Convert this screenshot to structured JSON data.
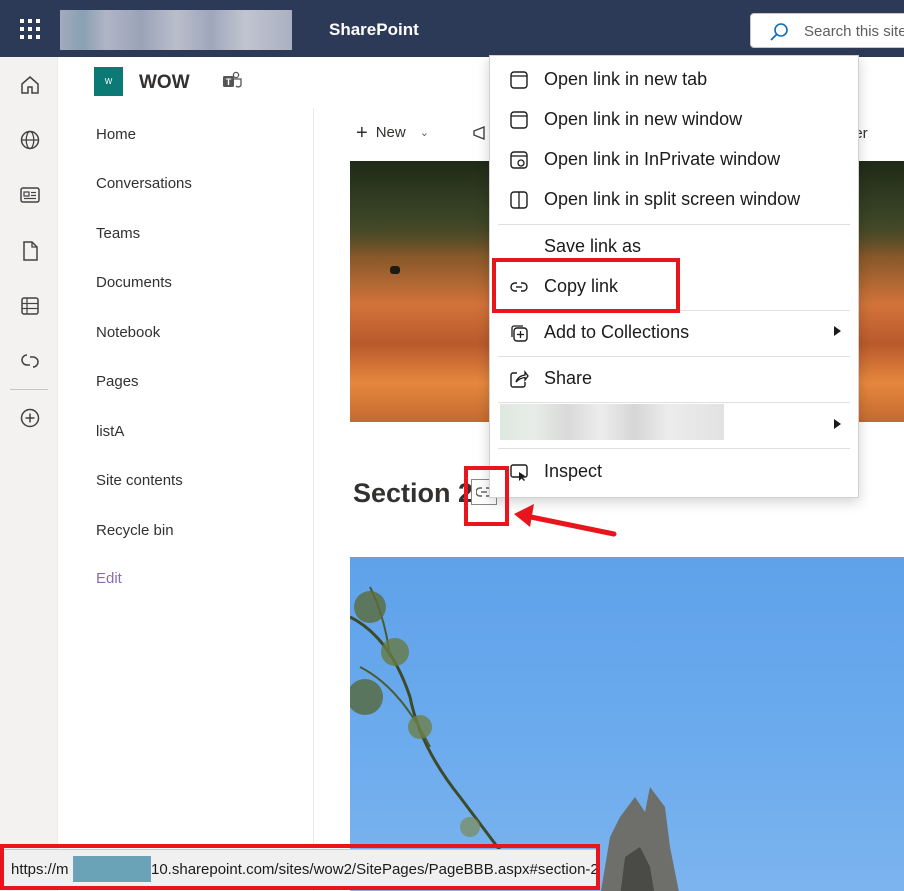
{
  "suite_bar": {
    "app_name": "SharePoint",
    "search_placeholder": "Search this site"
  },
  "app_bar": {
    "icons": [
      "home-icon",
      "globe-icon",
      "news-icon",
      "file-icon",
      "list-icon",
      "loop-icon",
      "add-icon"
    ]
  },
  "site": {
    "logo_text": "W",
    "name": "WOW"
  },
  "left_nav": {
    "items": [
      {
        "label": "Home"
      },
      {
        "label": "Conversations"
      },
      {
        "label": "Teams"
      },
      {
        "label": "Documents"
      },
      {
        "label": "Notebook"
      },
      {
        "label": "Pages"
      },
      {
        "label": "listA"
      },
      {
        "label": "Site contents"
      },
      {
        "label": "Recycle bin"
      }
    ],
    "edit_label": "Edit"
  },
  "command_bar": {
    "new_label": "New",
    "right_partial": "der"
  },
  "page": {
    "section_title": "Section 2"
  },
  "context_menu": {
    "items": [
      {
        "label": "Open link in new tab",
        "icon": "new-tab-icon"
      },
      {
        "label": "Open link in new window",
        "icon": "new-window-icon"
      },
      {
        "label": "Open link in InPrivate window",
        "icon": "inprivate-icon"
      },
      {
        "label": "Open link in split screen window",
        "icon": "split-screen-icon"
      },
      {
        "label": "Save link as",
        "icon": ""
      },
      {
        "label": "Copy link",
        "icon": "link-icon"
      },
      {
        "label": "Add to Collections",
        "icon": "collections-icon",
        "submenu": true
      },
      {
        "label": "Share",
        "icon": "share-icon"
      },
      {
        "label": "",
        "icon": "",
        "submenu": true,
        "blurred": true
      },
      {
        "label": "Inspect",
        "icon": "inspect-icon"
      }
    ]
  },
  "status_bar": {
    "url_prefix": "https://m",
    "url_suffix": "10.sharepoint.com/sites/wow2/SitePages/PageBBB.aspx#section-2"
  },
  "colors": {
    "suite_bar": "#2d3a57",
    "highlight_red": "#e8161c",
    "site_logo": "#0b7a75",
    "edit_link": "#8a6db1"
  }
}
